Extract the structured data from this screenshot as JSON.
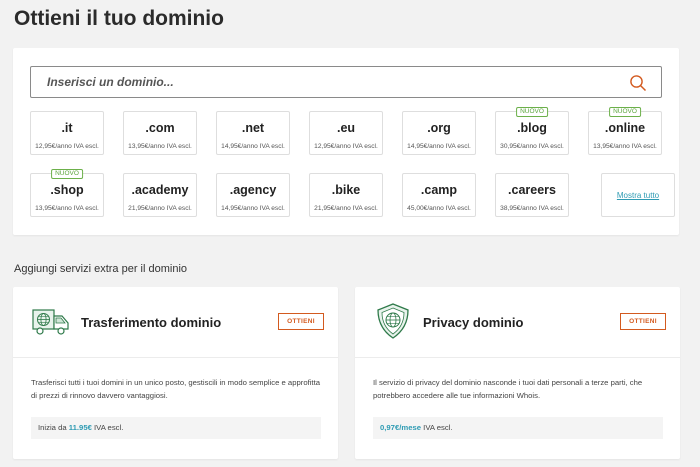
{
  "page_title": "Ottieni il tuo dominio",
  "search": {
    "placeholder": "Inserisci un dominio..."
  },
  "tlds_row1": [
    {
      "name": ".it",
      "price": "12,95€/anno IVA escl.",
      "badge": ""
    },
    {
      "name": ".com",
      "price": "13,95€/anno IVA escl.",
      "badge": ""
    },
    {
      "name": ".net",
      "price": "14,95€/anno IVA escl.",
      "badge": ""
    },
    {
      "name": ".eu",
      "price": "12,95€/anno IVA escl.",
      "badge": ""
    },
    {
      "name": ".org",
      "price": "14,95€/anno IVA escl.",
      "badge": ""
    },
    {
      "name": ".blog",
      "price": "30,95€/anno IVA escl.",
      "badge": "NUOVO"
    },
    {
      "name": ".online",
      "price": "13,95€/anno IVA escl.",
      "badge": "NUOVO"
    }
  ],
  "tlds_row2": [
    {
      "name": ".shop",
      "price": "13,95€/anno IVA escl.",
      "badge": "NUOVO"
    },
    {
      "name": ".academy",
      "price": "21,95€/anno IVA escl.",
      "badge": ""
    },
    {
      "name": ".agency",
      "price": "14,95€/anno IVA escl.",
      "badge": ""
    },
    {
      "name": ".bike",
      "price": "21,95€/anno IVA escl.",
      "badge": ""
    },
    {
      "name": ".camp",
      "price": "45,00€/anno IVA escl.",
      "badge": ""
    },
    {
      "name": ".careers",
      "price": "38,95€/anno IVA escl.",
      "badge": ""
    }
  ],
  "show_all": "Mostra tutto",
  "extra_title": "Aggiungi servizi extra per il dominio",
  "services": [
    {
      "title": "Trasferimento dominio",
      "button": "OTTIENI",
      "icon": "truck-globe-icon",
      "description": "Trasferisci tutti i tuoi domini in un unico posto, gestiscili in modo semplice e approfitta di prezzi di rinnovo davvero vantaggiosi.",
      "price_prefix": "Inizia da ",
      "price_value": "11.95€",
      "price_suffix": " IVA escl."
    },
    {
      "title": "Privacy dominio",
      "button": "OTTIENI",
      "icon": "shield-globe-icon",
      "description": "Il servizio di privacy del dominio nasconde i tuoi dati personali a terze parti, che potrebbero accedere alle tue informazioni Whois.",
      "price_prefix": "",
      "price_value": "0,97€/mese",
      "price_suffix": " IVA escl."
    }
  ],
  "colors": {
    "accent_orange": "#d35a1f",
    "link_teal": "#2e9bb3",
    "badge_green": "#6cb04a",
    "icon_green": "#2f7a4a"
  }
}
